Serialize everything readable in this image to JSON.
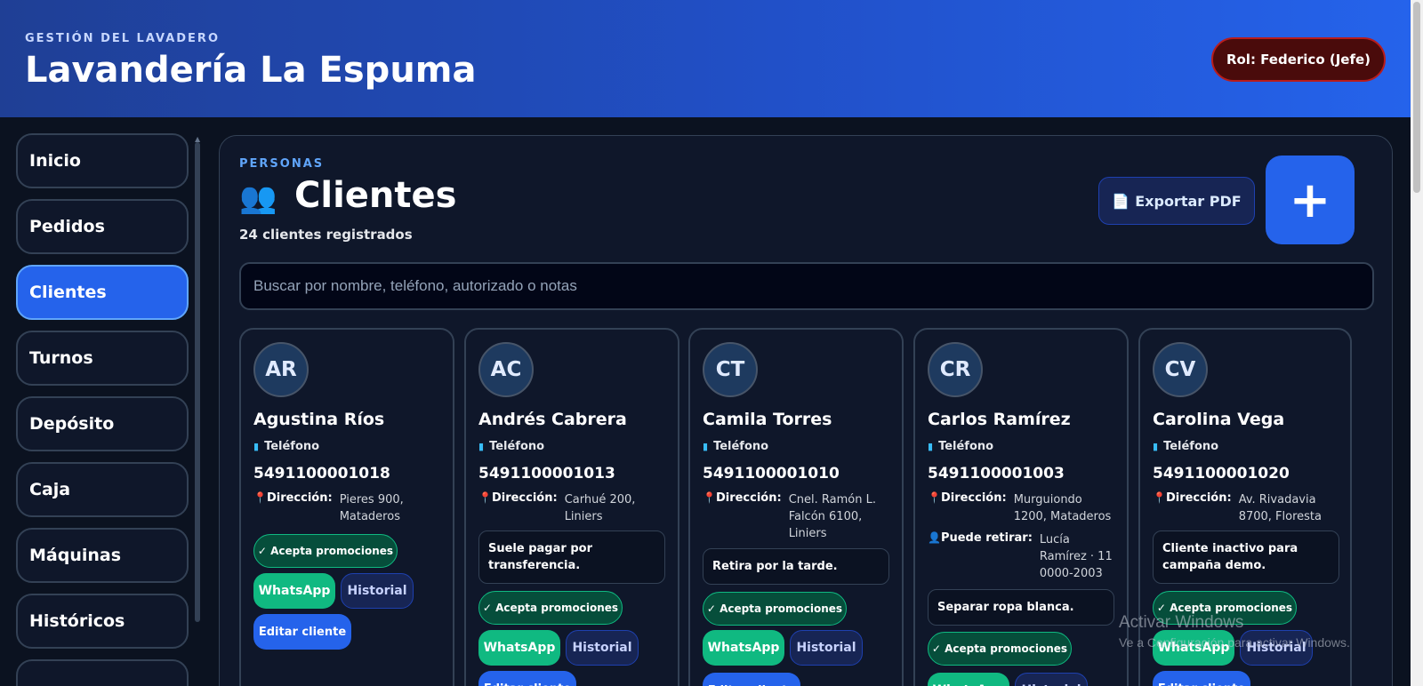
{
  "header": {
    "kicker": "GESTIÓN DEL LAVADERO",
    "title": "Lavandería La Espuma",
    "role": "Rol: Federico (Jefe)"
  },
  "sidebar": {
    "items": [
      {
        "label": "Inicio"
      },
      {
        "label": "Pedidos"
      },
      {
        "label": "Clientes",
        "active": true
      },
      {
        "label": "Turnos"
      },
      {
        "label": "Depósito"
      },
      {
        "label": "Caja"
      },
      {
        "label": "Máquinas"
      },
      {
        "label": "Históricos"
      }
    ]
  },
  "main": {
    "kicker": "PERSONAS",
    "title_icon": "👥",
    "title": "Clientes",
    "subtitle": "24 clientes registrados",
    "export_label": "Exportar PDF",
    "export_icon": "📄",
    "add_label": "+",
    "search_placeholder": "Buscar por nombre, teléfono, autorizado o notas"
  },
  "labels": {
    "phone": "Teléfono",
    "address": "Dirección:",
    "pickup": "Puede retirar:",
    "promo": "✓ Acepta promociones",
    "whatsapp": "WhatsApp",
    "history": "Historial",
    "edit": "Editar cliente"
  },
  "clients": [
    {
      "initials": "AR",
      "name": "Agustina Ríos",
      "phone": "5491100001018",
      "address": "Pieres 900, Mataderos"
    },
    {
      "initials": "AC",
      "name": "Andrés Cabrera",
      "phone": "5491100001013",
      "address": "Carhué 200, Liniers",
      "note": "Suele pagar por transferencia."
    },
    {
      "initials": "CT",
      "name": "Camila Torres",
      "phone": "5491100001010",
      "address": "Cnel. Ramón L. Falcón 6100, Liniers",
      "note": "Retira por la tarde."
    },
    {
      "initials": "CR",
      "name": "Carlos Ramírez",
      "phone": "5491100001003",
      "address": "Murguiondo 1200, Mataderos",
      "pickup": "Lucía Ramírez · 11 0000-2003",
      "note": "Separar ropa blanca."
    },
    {
      "initials": "CV",
      "name": "Carolina Vega",
      "phone": "5491100001020",
      "address": "Av. Rivadavia 8700, Floresta",
      "note": "Cliente inactivo para campaña demo."
    }
  ],
  "watermark": {
    "line1": "Activar Windows",
    "line2": "Ve a Configuración para activar Windows."
  },
  "colors": {
    "accent": "#2563eb",
    "whatsapp": "#10b981",
    "role_badge": "#4a0b0b"
  }
}
